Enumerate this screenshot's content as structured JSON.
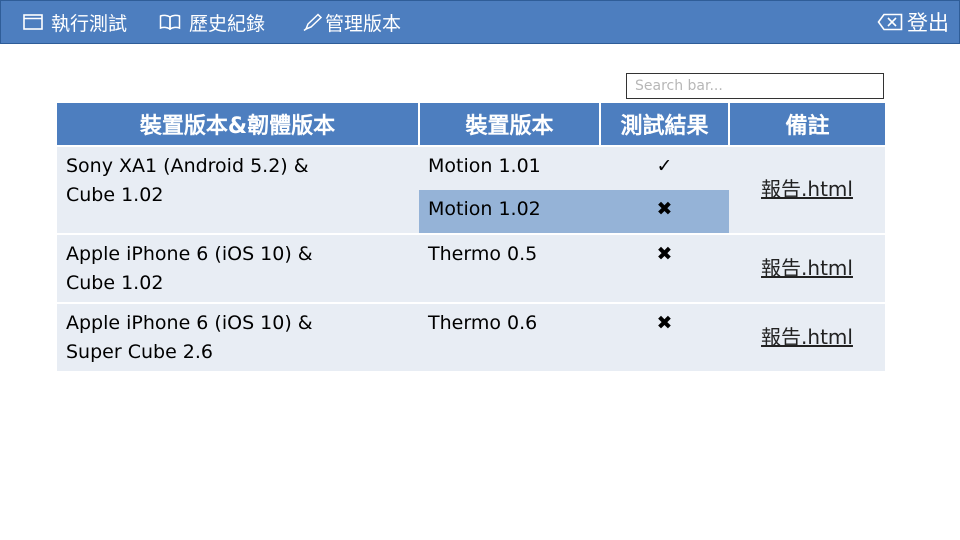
{
  "nav": {
    "run": {
      "label": "執行測試",
      "icon": "window-icon"
    },
    "history": {
      "label": "歷史紀錄",
      "icon": "book-icon"
    },
    "manage": {
      "label": "管理版本",
      "icon": "pencil-icon"
    },
    "logout": {
      "label": "登出",
      "icon": "logout-icon"
    }
  },
  "search": {
    "placeholder": "Search bar..."
  },
  "table": {
    "headers": [
      "裝置版本&韌體版本",
      "裝置版本",
      "測試結果",
      "備註"
    ],
    "rows": [
      {
        "device_line1": "Sony XA1 (Android 5.2) &",
        "device_line2": "Cube 1.02",
        "tests": [
          {
            "version": "Motion 1.01",
            "result": "✓"
          },
          {
            "version": "Motion 1.02",
            "result": "✖"
          }
        ],
        "note": "報告.html"
      },
      {
        "device_line1": "Apple iPhone 6 (iOS 10) &",
        "device_line2": "Cube 1.02",
        "tests": [
          {
            "version": "Thermo 0.5",
            "result": "✖"
          }
        ],
        "note": "報告.html"
      },
      {
        "device_line1": "Apple iPhone 6 (iOS 10) &",
        "device_line2": "Super Cube 2.6",
        "tests": [
          {
            "version": "Thermo 0.6",
            "result": "✖"
          }
        ],
        "note": "報告.html"
      }
    ]
  },
  "colors": {
    "header_blue": "#4d7ebf",
    "row_bg": "#e8edf4",
    "highlight": "#95b3d7"
  }
}
